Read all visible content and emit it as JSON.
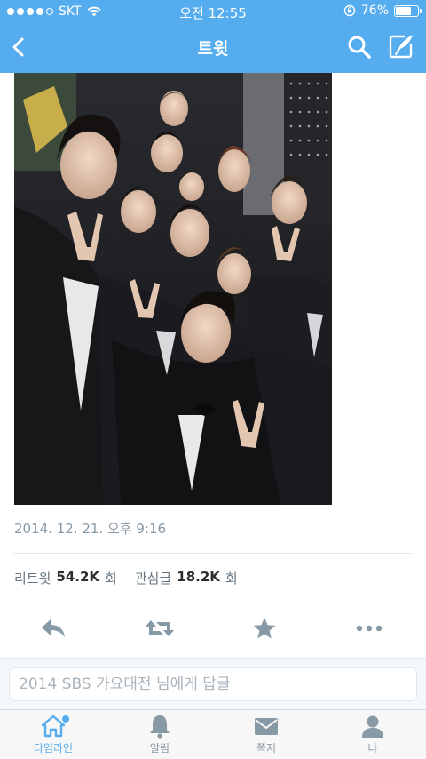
{
  "status_bar": {
    "carrier": "SKT",
    "time": "오전 12:55",
    "battery_percent": "76%",
    "battery_level": 0.76,
    "signal_bars": 4
  },
  "nav": {
    "title": "트윗",
    "back_icon": "chevron-left-icon",
    "search_icon": "search-icon",
    "compose_icon": "compose-icon"
  },
  "tweet": {
    "timestamp": "2014. 12. 21. 오후 9:16",
    "retweets_label": "리트윗",
    "retweets_count": "54.2K",
    "retweets_unit": "회",
    "favorites_label": "관심글",
    "favorites_count": "18.2K",
    "favorites_unit": "회"
  },
  "actions": [
    "reply-icon",
    "retweet-icon",
    "star-icon",
    "more-icon"
  ],
  "reply": {
    "placeholder": "2014 SBS 가요대전 님에게 답글"
  },
  "tabs": [
    {
      "label": "타임라인",
      "icon": "home-icon",
      "active": true
    },
    {
      "label": "알림",
      "icon": "bell-icon",
      "active": false
    },
    {
      "label": "쪽지",
      "icon": "envelope-icon",
      "active": false
    },
    {
      "label": "나",
      "icon": "person-icon",
      "active": false
    }
  ],
  "colors": {
    "brand": "#55acee",
    "photo_dark": "#1e1e22"
  }
}
